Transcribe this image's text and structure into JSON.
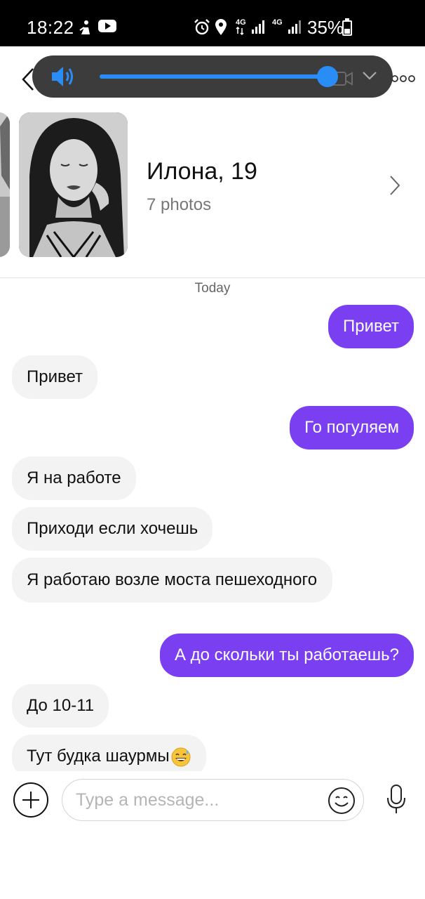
{
  "status_bar": {
    "time": "18:22",
    "network_left": "4G",
    "network_right": "4G",
    "battery": "35%"
  },
  "icons": {
    "back": "back-arrow-icon",
    "more": "more-options-icon",
    "volume": "speaker-volume-icon",
    "collapse": "chevron-down-icon",
    "open_profile": "chevron-right-icon",
    "attach": "plus-circle-icon",
    "emoji": "smiley-icon",
    "mic": "microphone-icon"
  },
  "colors": {
    "outgoing_bubble": "#7b3ff2",
    "incoming_bubble": "#f3f3f3",
    "volume_accent": "#2a8df5"
  },
  "volume": {
    "level": 0.98
  },
  "profile": {
    "name": "Илона, 19",
    "photos_count": "7 photos"
  },
  "chat": {
    "day_label": "Today",
    "messages": [
      {
        "direction": "out",
        "text": "Привет"
      },
      {
        "direction": "in",
        "text": "Привет"
      },
      {
        "direction": "out",
        "text": "Го погуляем"
      },
      {
        "direction": "in",
        "text": "Я на работе"
      },
      {
        "direction": "in",
        "text": "Приходи если хочешь"
      },
      {
        "direction": "in",
        "text": "Я работаю возле моста пешеходного"
      },
      {
        "direction": "out",
        "text": "А до скольки ты работаешь?"
      },
      {
        "direction": "in",
        "text": "До 10-11"
      },
      {
        "direction": "in",
        "text": "Тут будка шаурмы",
        "emoji": "grinning-sweat-emoji"
      }
    ]
  },
  "input": {
    "placeholder": "Type a message...",
    "value": ""
  }
}
